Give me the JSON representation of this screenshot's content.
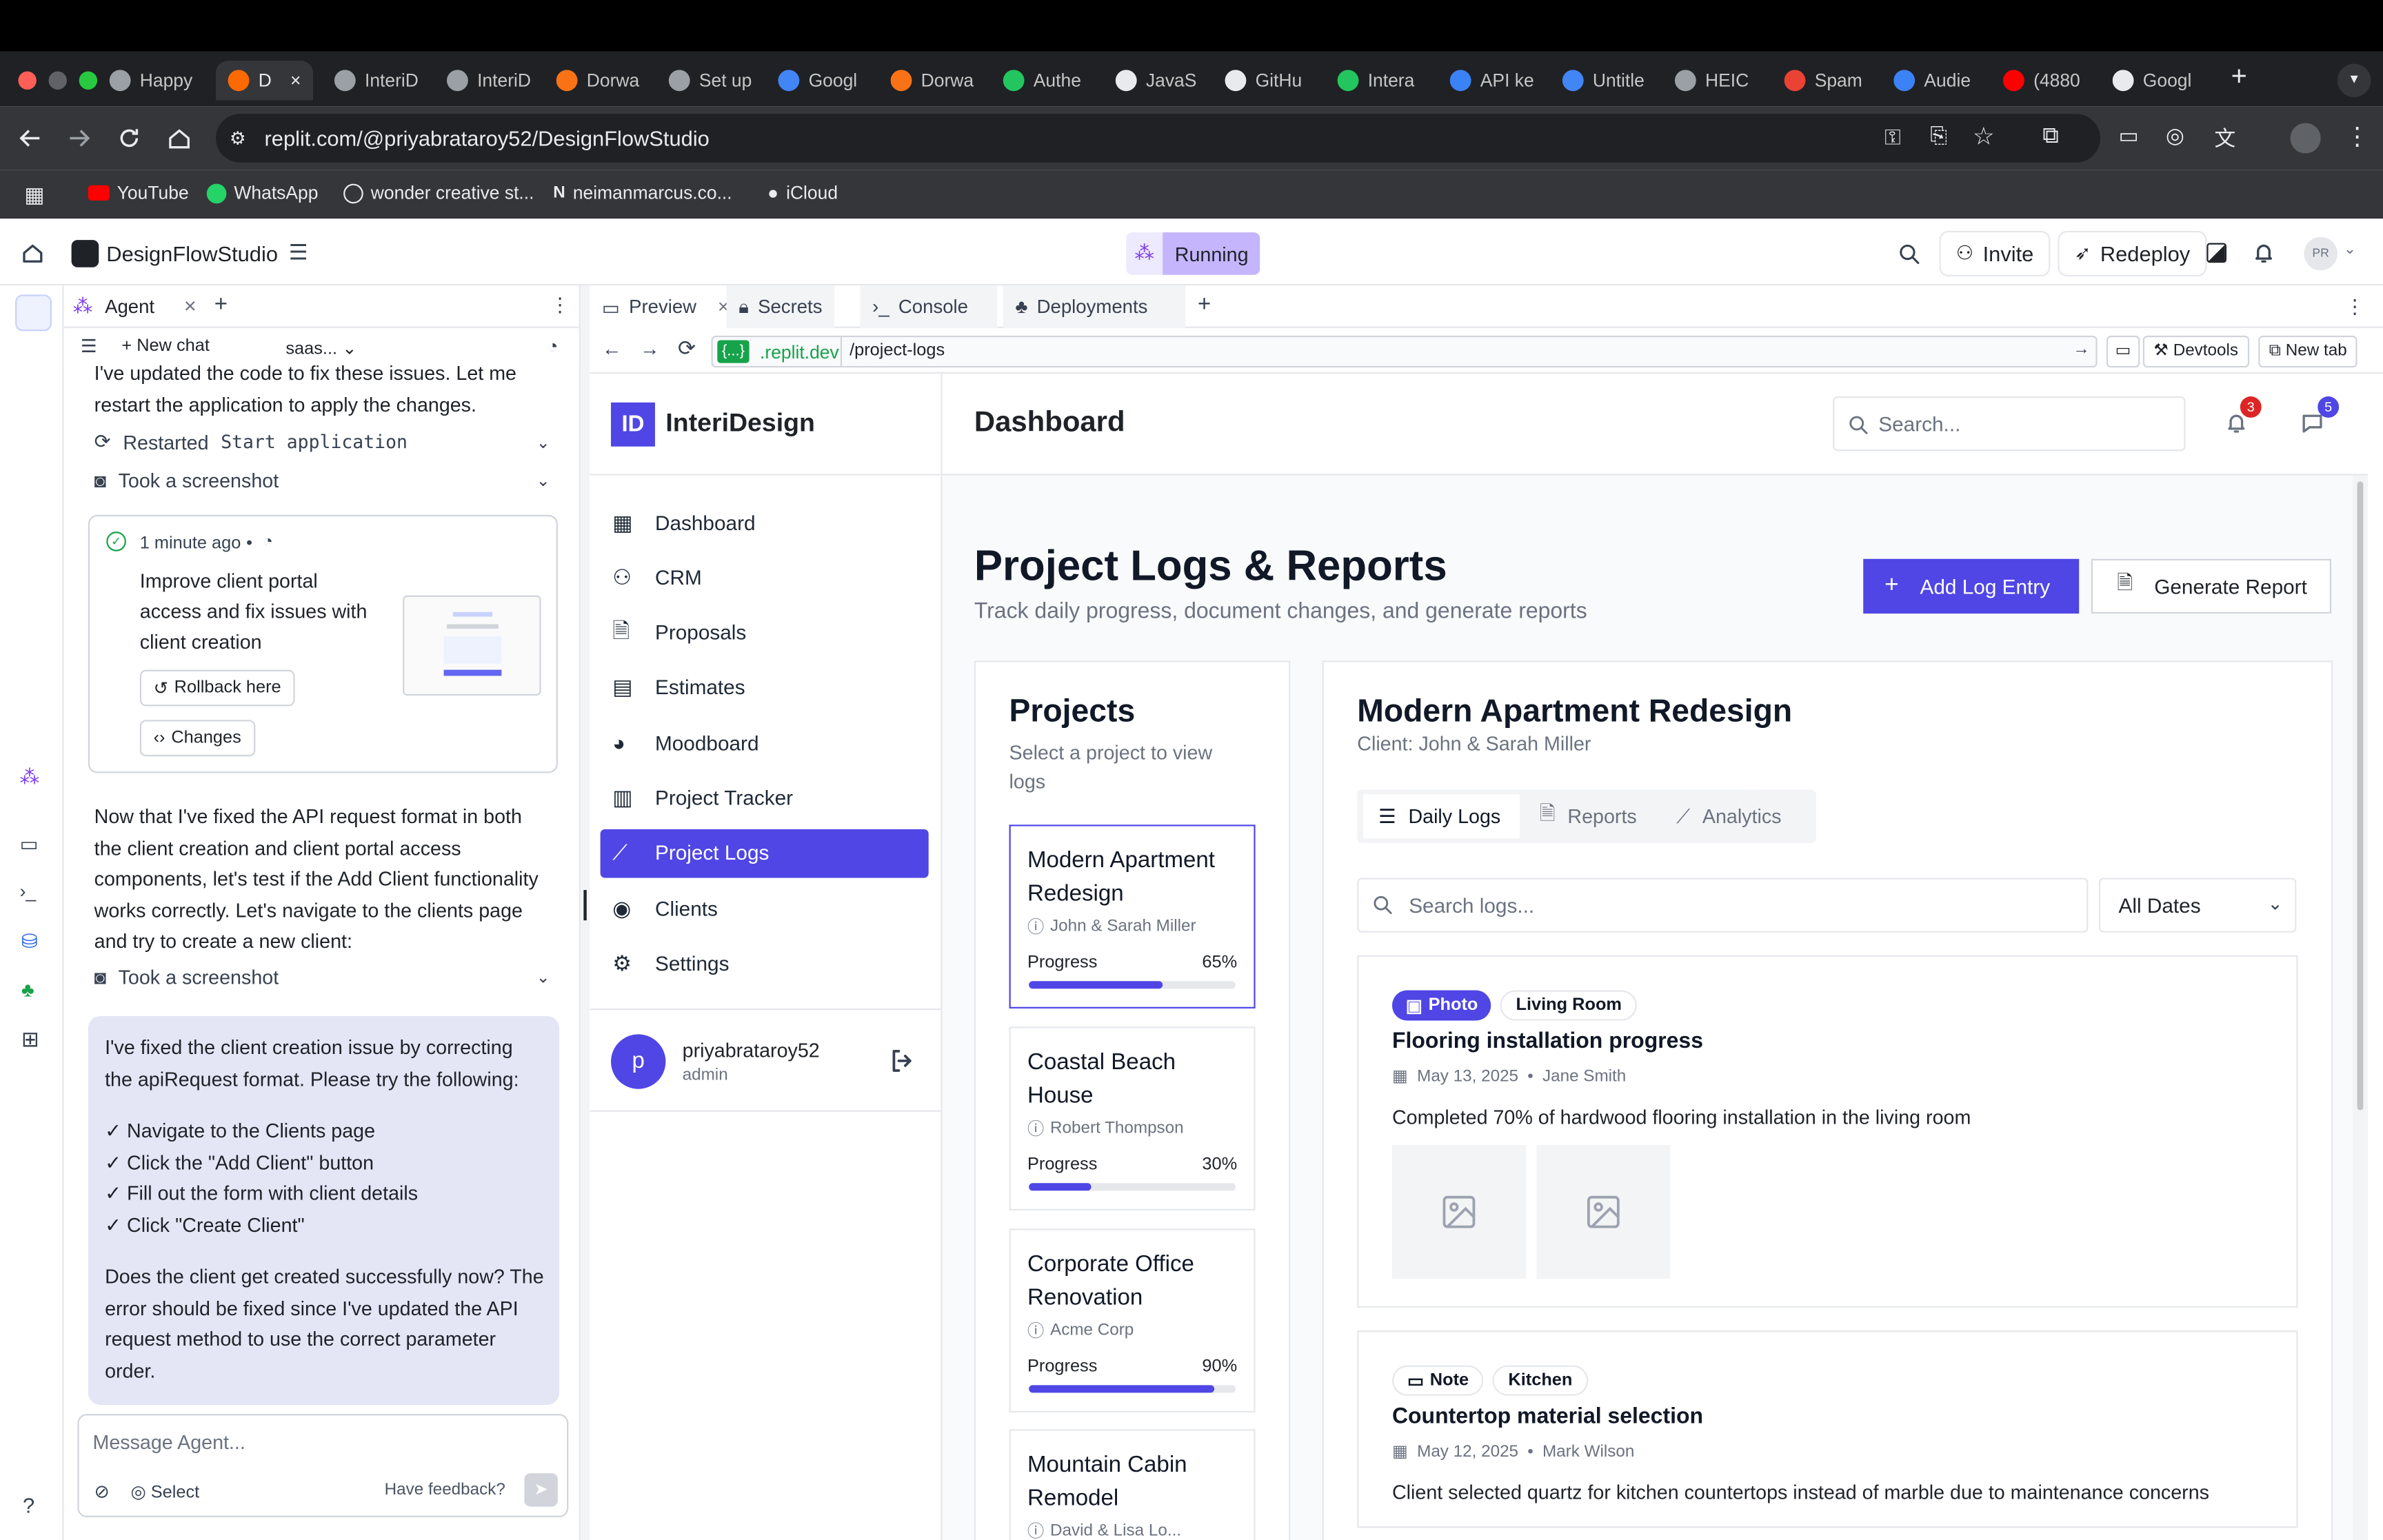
{
  "browser": {
    "tabs": [
      {
        "label": "Happy",
        "color": "#9aa0a6"
      },
      {
        "label": "D",
        "color": "#ff6a00",
        "active": true
      },
      {
        "label": "InteriD",
        "color": "#9aa0a6"
      },
      {
        "label": "InteriD",
        "color": "#9aa0a6"
      },
      {
        "label": "Dorwa",
        "color": "#f97316"
      },
      {
        "label": "Set up",
        "color": "#9aa0a6"
      },
      {
        "label": "Googl",
        "color": "#4285f4"
      },
      {
        "label": "Dorwa",
        "color": "#f97316"
      },
      {
        "label": "Authe",
        "color": "#22c55e"
      },
      {
        "label": "JavaS",
        "color": "#e8eaed"
      },
      {
        "label": "GitHu",
        "color": "#e8eaed"
      },
      {
        "label": "Intera",
        "color": "#22c55e"
      },
      {
        "label": "API ke",
        "color": "#3b82f6"
      },
      {
        "label": "Untitle",
        "color": "#4285f4"
      },
      {
        "label": "HEIC",
        "color": "#9aa0a6"
      },
      {
        "label": "Spam",
        "color": "#ea4335"
      },
      {
        "label": "Audie",
        "color": "#3b82f6"
      },
      {
        "label": "(4880",
        "color": "#ff0000"
      },
      {
        "label": "Googl",
        "color": "#e8eaed"
      }
    ],
    "url": "replit.com/@priyabrataroy52/DesignFlowStudio",
    "bookmarks": [
      "YouTube",
      "WhatsApp",
      "wonder creative st...",
      "neimanmarcus.co...",
      "iCloud"
    ]
  },
  "replit": {
    "project_name": "DesignFlowStudio",
    "status": "Running",
    "invite_label": "Invite",
    "redeploy_label": "Redeploy",
    "avatar_initials": "PR",
    "agent_tab": "Agent",
    "new_chat": "New chat",
    "chat_name": "saas...",
    "msg1": "I've updated the code to fix these issues. Let me restart the application to apply the changes.",
    "restarted_label": "Restarted",
    "restarted_code": "Start application",
    "screenshot_label": "Took a screenshot",
    "checkpoint_time": "1 minute ago",
    "checkpoint_text": "Improve client portal access and fix issues with client creation",
    "rollback_label": "Rollback here",
    "changes_label": "Changes",
    "msg2": "Now that I've fixed the API request format in both the client creation and client portal access components, let's test if the Add Client functionality works correctly. Let's navigate to the clients page and try to create a new client:",
    "screenshot_label2": "Took a screenshot",
    "summary_intro": "I've fixed the client creation issue by correcting the apiRequest format. Please try the following:",
    "summary_steps": [
      "✓ Navigate to the Clients page",
      "✓ Click the \"Add Client\" button",
      "✓ Fill out the form with client details",
      "✓ Click \"Create Client\""
    ],
    "summary_outro": "Does the client get created successfully now? The error should be fixed since I've updated the API request method to use the correct parameter order.",
    "message_placeholder": "Message Agent...",
    "select_label": "Select",
    "feedback_label": "Have feedback?",
    "pane_tabs": [
      "Preview",
      "Secrets",
      "Console",
      "Deployments"
    ],
    "preview_domain": ".replit.dev",
    "preview_domain_prefix": "{...}",
    "preview_path": "/project-logs",
    "devtools_label": "Devtools",
    "newtab_label": "New tab"
  },
  "app": {
    "logo_mark": "ID",
    "brand": "InteriDesign",
    "nav": [
      "Dashboard",
      "CRM",
      "Proposals",
      "Estimates",
      "Moodboard",
      "Project Tracker",
      "Project Logs",
      "Clients",
      "Settings"
    ],
    "active_nav": "Project Logs",
    "user": {
      "initial": "p",
      "name": "priyabrataroy52",
      "role": "admin"
    },
    "header_title": "Dashboard",
    "search_placeholder": "Search...",
    "notif_count": "3",
    "msg_count": "5",
    "page_title": "Project Logs & Reports",
    "page_subtitle": "Track daily progress, document changes, and generate reports",
    "add_log_label": "Add Log Entry",
    "generate_report_label": "Generate Report",
    "projects_title": "Projects",
    "projects_subtitle": "Select a project to view logs",
    "progress_label": "Progress",
    "projects": [
      {
        "name": "Modern Apartment Redesign",
        "client": "John & Sarah Miller",
        "progress": 65,
        "progress_text": "65%"
      },
      {
        "name": "Coastal Beach House",
        "client": "Robert Thompson",
        "progress": 30,
        "progress_text": "30%"
      },
      {
        "name": "Corporate Office Renovation",
        "client": "Acme Corp",
        "progress": 90,
        "progress_text": "90%"
      },
      {
        "name": "Mountain Cabin Remodel",
        "client": "David & Lisa Lo...",
        "progress": 0,
        "progress_text": ""
      }
    ],
    "detail_title": "Modern Apartment Redesign",
    "detail_client": "Client: John & Sarah Miller",
    "detail_tabs": [
      "Daily Logs",
      "Reports",
      "Analytics"
    ],
    "logs_search_placeholder": "Search logs...",
    "date_filter": "All Dates",
    "logs": [
      {
        "type": "Photo",
        "room": "Living Room",
        "title": "Flooring installation progress",
        "date": "May 13, 2025",
        "author": "Jane Smith",
        "body": "Completed 70% of hardwood flooring installation in the living room"
      },
      {
        "type": "Note",
        "room": "Kitchen",
        "title": "Countertop material selection",
        "date": "May 12, 2025",
        "author": "Mark Wilson",
        "body": "Client selected quartz for kitchen countertops instead of marble due to maintenance concerns"
      }
    ]
  },
  "colors": {
    "accent": "#4f46e5",
    "replit_orange": "#f26207",
    "running_bg": "#c4b5fd"
  }
}
